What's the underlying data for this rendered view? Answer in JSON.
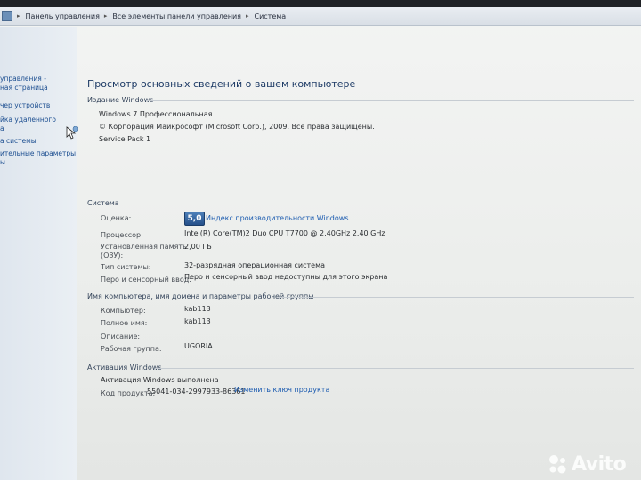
{
  "address_bar": {
    "crumbs": [
      "Панель управления",
      "Все элементы панели управления",
      "Система"
    ]
  },
  "sidebar": {
    "items": [
      "управления -",
      "ная страница",
      "чер устройств",
      "йка удаленного",
      "а",
      "а системы",
      "ительные параметры",
      "ы"
    ]
  },
  "main": {
    "page_title": "Просмотр основных сведений о вашем компьютере",
    "edition": {
      "title": "Издание Windows",
      "name": "Windows 7 Профессиональная",
      "copyright": "© Корпорация Майкрософт (Microsoft Corp.), 2009. Все права защищены.",
      "service_pack": "Service Pack 1"
    },
    "system": {
      "title": "Система",
      "rating_label": "Оценка:",
      "rating_value": "5,0",
      "rating_link": "Индекс производительности Windows",
      "cpu_label": "Процессор:",
      "cpu_value": "Intel(R) Core(TM)2 Duo CPU     T7700  @ 2.40GHz   2.40 GHz",
      "ram_label_1": "Установленная память",
      "ram_label_2": "(ОЗУ):",
      "ram_value": "2,00 ГБ",
      "type_label": "Тип системы:",
      "type_value": "32-разрядная операционная система",
      "pen_label": "Перо и сенсорный ввод:",
      "pen_value": "Перо и сенсорный ввод недоступны для этого экрана"
    },
    "computer": {
      "title": "Имя компьютера, имя домена и параметры рабочей группы",
      "name_label": "Компьютер:",
      "name_value": "kab113",
      "full_label": "Полное имя:",
      "full_value": "kab113",
      "desc_label": "Описание:",
      "group_label": "Рабочая группа:",
      "group_value": "UGORIA"
    },
    "activation": {
      "title": "Активация Windows",
      "status": "Активация Windows выполнена",
      "key_label": "Код продукта:",
      "key_value": "55041-034-2997933-86361",
      "change_link": "Изменить ключ продукта"
    }
  },
  "watermark": {
    "text": "Avito"
  },
  "colors": {
    "link": "#1c5bb0",
    "title": "#1e3b66",
    "badge": "#25508a"
  }
}
